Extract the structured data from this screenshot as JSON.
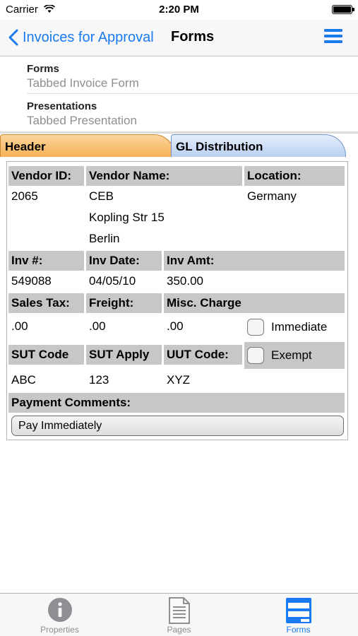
{
  "status_bar": {
    "carrier": "Carrier",
    "time": "2:20 PM"
  },
  "nav": {
    "back_label": "Invoices for Approval",
    "title": "Forms"
  },
  "list": [
    {
      "title": "Forms",
      "subtitle": "Tabbed Invoice Form"
    },
    {
      "title": "Presentations",
      "subtitle": "Tabbed Presentation"
    }
  ],
  "tabs": {
    "header": "Header",
    "gl": "GL Distribution",
    "active": "Header"
  },
  "form": {
    "vendor_id_label": "Vendor ID:",
    "vendor_name_label": "Vendor Name:",
    "location_label": "Location:",
    "vendor_id": "2065",
    "vendor_name": "CEB",
    "address_line": "Kopling Str 15",
    "city": "Berlin",
    "location": "Germany",
    "inv_no_label": "Inv #:",
    "inv_date_label": "Inv Date:",
    "inv_amt_label": "Inv Amt:",
    "inv_no": "549088",
    "inv_date": "04/05/10",
    "inv_amt": "350.00",
    "sales_tax_label": "Sales Tax:",
    "freight_label": "Freight:",
    "misc_label": "Misc. Charge",
    "sales_tax": ".00",
    "freight": ".00",
    "misc": ".00",
    "immediate_label": "Immediate",
    "immediate_checked": false,
    "sut_code_label": "SUT Code",
    "sut_apply_label": "SUT Apply",
    "uut_code_label": "UUT Code:",
    "exempt_label": "Exempt",
    "exempt_checked": false,
    "sut_code": "ABC",
    "sut_apply": "123",
    "uut_code": "XYZ",
    "payment_comments_label": "Payment Comments:",
    "payment_comments": "Pay Immediately"
  },
  "tab_bar": [
    {
      "label": "Properties",
      "icon": "info-icon",
      "active": false
    },
    {
      "label": "Pages",
      "icon": "pages-icon",
      "active": false
    },
    {
      "label": "Forms",
      "icon": "forms-icon",
      "active": true
    }
  ],
  "colors": {
    "accent": "#1a7bf0",
    "header_tab": "#f5b156",
    "gl_tab": "#b9d0f2",
    "field_header": "#c7c7c7"
  }
}
